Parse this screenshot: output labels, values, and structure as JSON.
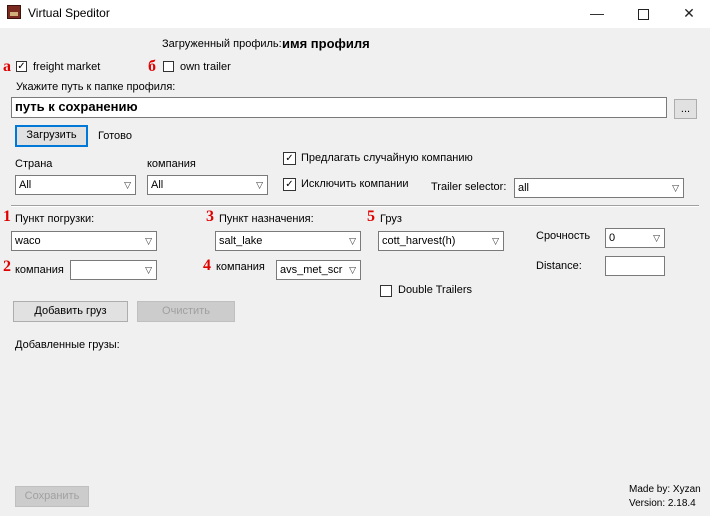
{
  "window": {
    "title": "Virtual Speditor",
    "minimize": "—",
    "close": "✕"
  },
  "profile": {
    "loaded_label": "Загруженный профиль:",
    "loaded_name": "имя профиля"
  },
  "markers": {
    "a": "а",
    "b": "б",
    "m1": "1",
    "m2": "2",
    "m3": "3",
    "m4": "4",
    "m5": "5"
  },
  "options": {
    "freight_market": "freight market",
    "own_trailer": "own trailer",
    "freight_market_checked": true,
    "own_trailer_checked": false
  },
  "path": {
    "label": "Укажите путь к папке профиля:",
    "value": "путь к сохранению",
    "browse": "..."
  },
  "load": {
    "button": "Загрузить",
    "status": "Готово"
  },
  "filters": {
    "country_label": "Страна",
    "country_value": "All",
    "company_label": "компания",
    "company_value": "All",
    "random_company": "Предлагать случайную компанию",
    "exclude_companies": "Исключить компании",
    "trailer_selector_label": "Trailer selector:",
    "trailer_selector_value": "all"
  },
  "cargo": {
    "origin_label": "Пункт погрузки:",
    "origin_value": "waco",
    "origin_company_label": "компания",
    "origin_company_value": "",
    "dest_label": "Пункт назначения:",
    "dest_value": "salt_lake",
    "dest_company_label": "компания",
    "dest_company_value": "avs_met_scr",
    "cargo_label": "Груз",
    "cargo_value": "cott_harvest(h)",
    "urgency_label": "Срочность",
    "urgency_value": "0",
    "distance_label": "Distance:",
    "distance_value": "",
    "double_trailers": "Double Trailers"
  },
  "actions": {
    "add": "Добавить груз",
    "clear": "Очистить",
    "added_label": "Добавленные грузы:",
    "save": "Сохранить"
  },
  "footer": {
    "made_by": "Made by: Xyzan",
    "version": "Version: 2.18.4"
  }
}
